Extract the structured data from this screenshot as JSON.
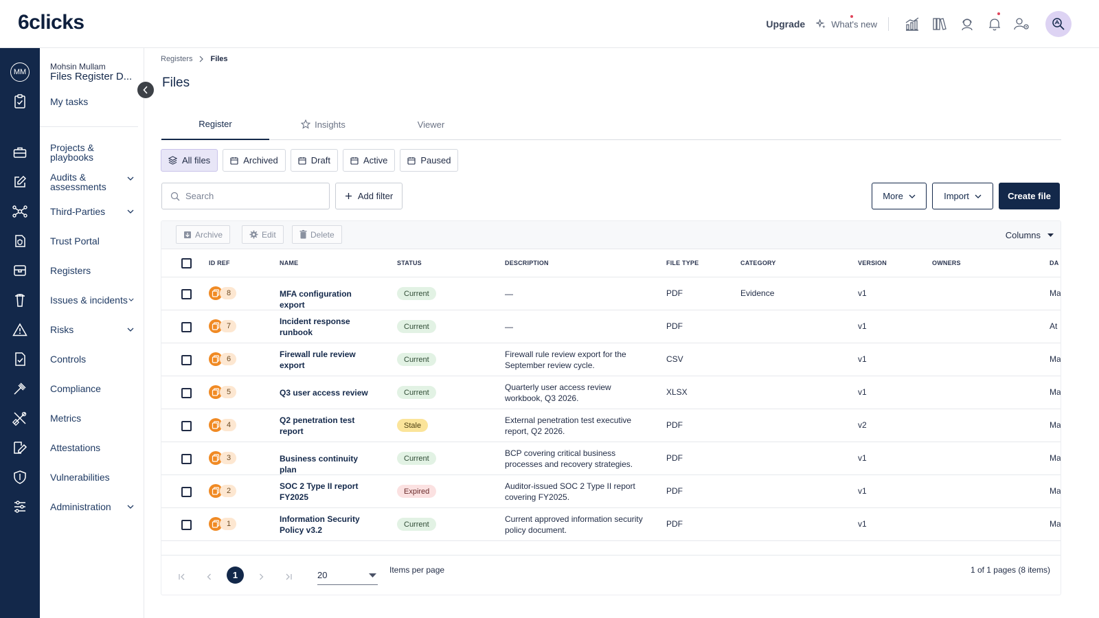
{
  "app": {
    "logo_text": "6clicks"
  },
  "header": {
    "upgrade_label": "Upgrade",
    "whats_new_label": "What's new",
    "icons": [
      "analytics-icon",
      "library-icon",
      "support-icon",
      "bell-icon",
      "user-settings-icon",
      "ai-search-icon"
    ]
  },
  "rail": {
    "avatar_initials": "MM"
  },
  "nav": {
    "user_name": "Mohsin Mullam",
    "register_name": "Files Register D...",
    "items": [
      {
        "label": "My tasks"
      },
      {
        "label": "Projects & playbooks"
      },
      {
        "label": "Audits & assessments"
      },
      {
        "label": "Third-Parties"
      },
      {
        "label": "Trust Portal"
      },
      {
        "label": "Registers"
      },
      {
        "label": "Issues & incidents"
      },
      {
        "label": "Risks"
      },
      {
        "label": "Controls"
      },
      {
        "label": "Compliance"
      },
      {
        "label": "Metrics"
      },
      {
        "label": "Attestations"
      },
      {
        "label": "Vulnerabilities"
      },
      {
        "label": "Administration"
      }
    ]
  },
  "breadcrumb": {
    "parent": "Registers",
    "current": "Files"
  },
  "page_title": "Files",
  "tabs": [
    {
      "label": "Register",
      "active": true
    },
    {
      "label": "Insights",
      "active": false
    },
    {
      "label": "Viewer",
      "active": false
    }
  ],
  "filters": [
    {
      "label": "All files",
      "active": true
    },
    {
      "label": "Archived",
      "active": false
    },
    {
      "label": "Draft",
      "active": false
    },
    {
      "label": "Active",
      "active": false
    },
    {
      "label": "Paused",
      "active": false
    }
  ],
  "search": {
    "placeholder": "Search"
  },
  "actions": {
    "add_filter": "Add filter",
    "more": "More",
    "import": "Import",
    "create": "Create file"
  },
  "toolbar": {
    "archive": "Archive",
    "edit": "Edit",
    "delete": "Delete",
    "columns": "Columns"
  },
  "table": {
    "columns": [
      "ID REF",
      "NAME",
      "STATUS",
      "DESCRIPTION",
      "FILE TYPE",
      "CATEGORY",
      "VERSION",
      "OWNERS",
      "DA"
    ],
    "rows": [
      {
        "id": "8",
        "name": "MFA configuration export",
        "status": "Current",
        "description": "—",
        "file_type": "PDF",
        "category": "Evidence",
        "version": "v1",
        "owners": "",
        "date": "Ma"
      },
      {
        "id": "7",
        "name": "Incident response runbook",
        "status": "Current",
        "description": "—",
        "file_type": "PDF",
        "category": "",
        "version": "v1",
        "owners": "",
        "date": "At"
      },
      {
        "id": "6",
        "name": "Firewall rule review export",
        "status": "Current",
        "description": "Firewall rule review export for the September review cycle.",
        "file_type": "CSV",
        "category": "",
        "version": "v1",
        "owners": "",
        "date": "Ma"
      },
      {
        "id": "5",
        "name": "Q3 user access review",
        "status": "Current",
        "description": "Quarterly user access review workbook, Q3 2026.",
        "file_type": "XLSX",
        "category": "",
        "version": "v1",
        "owners": "",
        "date": "Ma"
      },
      {
        "id": "4",
        "name": "Q2 penetration test report",
        "status": "Stale",
        "description": "External penetration test executive report, Q2 2026.",
        "file_type": "PDF",
        "category": "",
        "version": "v2",
        "owners": "",
        "date": "Ma"
      },
      {
        "id": "3",
        "name": "Business continuity plan",
        "status": "Current",
        "description": "BCP covering critical business processes and recovery strategies.",
        "file_type": "PDF",
        "category": "",
        "version": "v1",
        "owners": "",
        "date": "Ma"
      },
      {
        "id": "2",
        "name": "SOC 2 Type II report FY2025",
        "status": "Expired",
        "description": "Auditor-issued SOC 2 Type II report covering FY2025.",
        "file_type": "PDF",
        "category": "",
        "version": "v1",
        "owners": "",
        "date": "Ma"
      },
      {
        "id": "1",
        "name": "Information Security Policy v3.2",
        "status": "Current",
        "description": "Current approved information security policy document.",
        "file_type": "PDF",
        "category": "",
        "version": "v1",
        "owners": "",
        "date": "Ma"
      }
    ]
  },
  "pagination": {
    "current_page": "1",
    "per_page": "20",
    "per_page_label": "Items per page",
    "info": "1 of 1 pages (8 items)"
  },
  "colors": {
    "navy": "#13284a",
    "accent_orange": "#f08a24",
    "status_current": "#e2f2e4",
    "status_stale": "#fbe49a",
    "status_expired": "#fbe1e1"
  }
}
